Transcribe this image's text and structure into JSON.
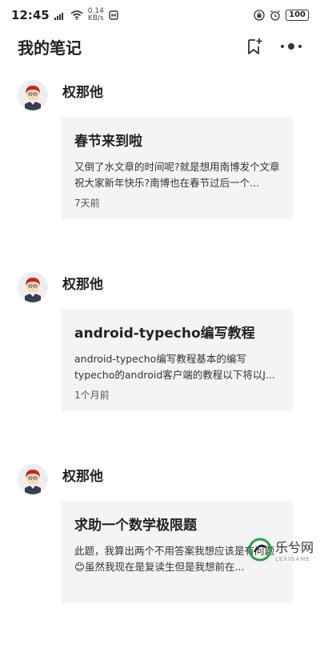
{
  "status_bar": {
    "time": "12:45",
    "net_speed_value": "0.14",
    "net_speed_unit": "KB/s",
    "battery": "100"
  },
  "app_bar": {
    "title": "我的笔记"
  },
  "posts": [
    {
      "author": "权那他",
      "title": "春节来到啦",
      "summary": "又倒了水文章的时间呢?就是想用南博发个文章祝大家新年快乐?南博也在春节过后一个...",
      "time": "7天前"
    },
    {
      "author": "权那他",
      "title": "android-typecho编写教程",
      "summary": "android-typecho编写教程基本的编写typecho的android客户端的教程以下将以J...",
      "time": "1个月前"
    },
    {
      "author": "权那他",
      "title": "求助一个数学极限题",
      "summary": "此题，我算出两个不用答案我想应该是有问题😊虽然我现在是复读生但是我想前在...",
      "time": ""
    }
  ],
  "watermark": {
    "text": "乐兮网",
    "sub": "LEXIGAME"
  }
}
